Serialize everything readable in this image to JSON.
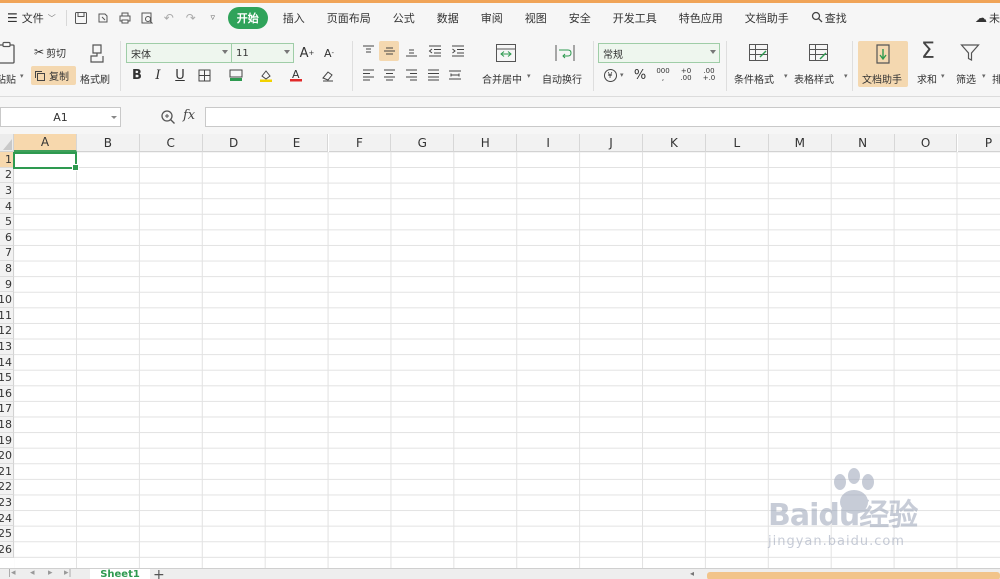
{
  "menubar": {
    "file_label": "文件",
    "tabs": [
      "开始",
      "插入",
      "页面布局",
      "公式",
      "数据",
      "审阅",
      "视图",
      "安全",
      "开发工具",
      "特色应用",
      "文档助手"
    ],
    "active_tab": "开始",
    "search_label": "查找",
    "right_label": "未"
  },
  "ribbon": {
    "paste_label": "粘贴",
    "cut_label": "剪切",
    "copy_label": "复制",
    "format_painter_label": "格式刷",
    "font_name": "宋体",
    "font_size": "11",
    "merge_label": "合并居中",
    "wrap_label": "自动换行",
    "number_format": "常规",
    "cond_format_label": "条件格式",
    "table_style_label": "表格样式",
    "doc_helper_label": "文档助手",
    "sum_label": "求和",
    "filter_label": "筛选",
    "sort_label": "排",
    "bold": "B",
    "italic": "I",
    "underline": "U",
    "percent": "%",
    "thousands": "000",
    "inc_decimal_top": "+0",
    "inc_decimal_bottom": ".00",
    "dec_decimal_top": ".00",
    "dec_decimal_bottom": "+.0"
  },
  "formula_bar": {
    "name_box": "A1",
    "fx_label": "fx",
    "formula": ""
  },
  "grid": {
    "columns": [
      "A",
      "B",
      "C",
      "D",
      "E",
      "F",
      "G",
      "H",
      "I",
      "J",
      "K",
      "L",
      "M",
      "N",
      "O",
      "P"
    ],
    "rows": [
      "1",
      "2",
      "3",
      "4",
      "5",
      "6",
      "7",
      "8",
      "9",
      "10",
      "11",
      "12",
      "13",
      "14",
      "15",
      "16",
      "17",
      "18",
      "19",
      "20",
      "21",
      "22",
      "23",
      "24",
      "25",
      "26"
    ],
    "selected_column": "A",
    "selected_row": "1"
  },
  "sheets": {
    "tabs": [
      "Sheet1"
    ],
    "add_label": "+"
  },
  "watermark": {
    "brand": "Baidu经验",
    "url": "jingyan.baidu.com"
  },
  "colors": {
    "accent_green": "#2e9a50",
    "header_highlight": "#f7d8ad",
    "top_strip": "#f0a458"
  }
}
